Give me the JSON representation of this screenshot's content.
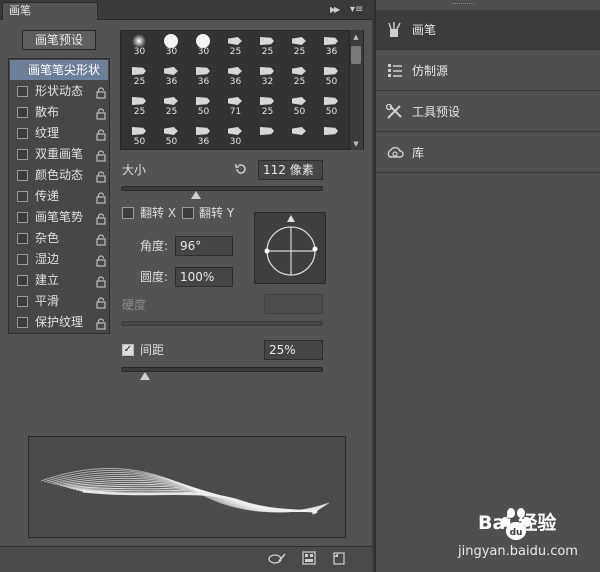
{
  "panel": {
    "tab_title": "画笔",
    "preset_button": "画笔预设",
    "selected_option": "画笔笔尖形状",
    "options": [
      "形状动态",
      "散布",
      "纹理",
      "双重画笔",
      "颜色动态",
      "传递",
      "画笔笔势",
      "杂色",
      "湿边",
      "建立",
      "平滑",
      "保护纹理"
    ]
  },
  "brush_sizes": [
    [
      "30",
      "30",
      "30",
      "25",
      "25",
      "25",
      "36"
    ],
    [
      "25",
      "36",
      "36",
      "36",
      "32",
      "25",
      "50"
    ],
    [
      "25",
      "25",
      "50",
      "71",
      "25",
      "50",
      "50"
    ],
    [
      "50",
      "50",
      "36",
      "30",
      "",
      "",
      ""
    ]
  ],
  "size": {
    "label": "大小",
    "value": "112 像素",
    "fraction": 0.37
  },
  "flip": {
    "x_label": "翻转 X",
    "y_label": "翻转 Y"
  },
  "angle": {
    "label": "角度:",
    "value": "96°"
  },
  "roundness": {
    "label": "圆度:",
    "value": "100%"
  },
  "hardness": {
    "label": "硬度",
    "value": ""
  },
  "spacing": {
    "label": "间距",
    "value": "25%",
    "checked": true,
    "fraction": 0.12
  },
  "dock": {
    "items": [
      {
        "label": "画笔",
        "icon": "brush-icon",
        "active": true
      },
      {
        "label": "仿制源",
        "icon": "clone-source-icon",
        "active": false
      },
      {
        "label": "工具预设",
        "icon": "tool-presets-icon",
        "active": false
      },
      {
        "label": "库",
        "icon": "libraries-icon",
        "active": false
      }
    ]
  },
  "watermark": {
    "brand": "Bai 经验",
    "url": "jingyan.baidu.com"
  },
  "colors": {
    "panel_bg": "#535353",
    "selected": "#6d7e98",
    "dock_bg": "#4f4f4f"
  }
}
